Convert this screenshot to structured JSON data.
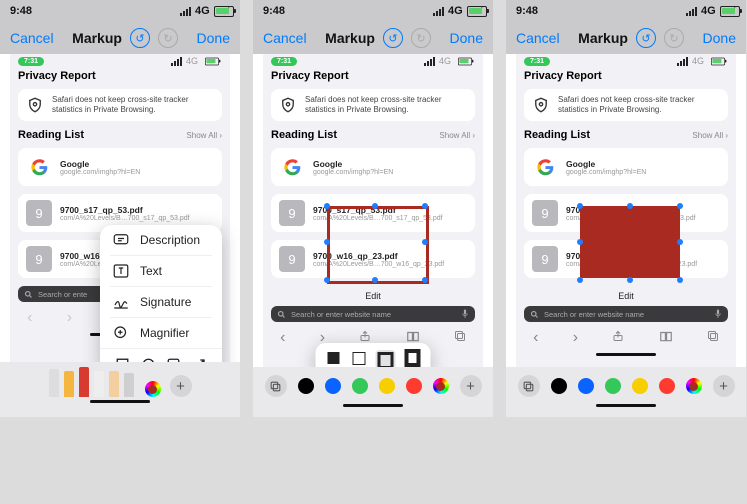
{
  "ios": {
    "time": "9:48",
    "net": "4G"
  },
  "markup": {
    "cancel": "Cancel",
    "title": "Markup",
    "done": "Done"
  },
  "inner": {
    "time": "7:31",
    "net": "4G"
  },
  "privacy": {
    "heading": "Privacy Report",
    "text": "Safari does not keep cross-site tracker statistics in Private Browsing."
  },
  "reading": {
    "heading": "Reading List",
    "show_all": "Show All",
    "items": [
      {
        "title": "Google",
        "url": "google.com/imghp?hl=EN"
      },
      {
        "title": "9700_s17_qp_53.pdf",
        "url": "com/A%20Levels/B…700_s17_qp_53.pdf"
      },
      {
        "title": "9700_w16_qp_23.pdf",
        "url": "com/A%20Levels/B…700_w16_qp_23.pdf"
      }
    ]
  },
  "edit": "Edit",
  "search": {
    "placeholder": "Search or enter website name",
    "placeholder_short": "Search or ente"
  },
  "popover": {
    "description": "Description",
    "text": "Text",
    "signature": "Signature",
    "magnifier": "Magnifier"
  },
  "colors": [
    "#000000",
    "#0a63ff",
    "#34c759",
    "#f7ce00",
    "#ff3b30"
  ],
  "nine": "9"
}
